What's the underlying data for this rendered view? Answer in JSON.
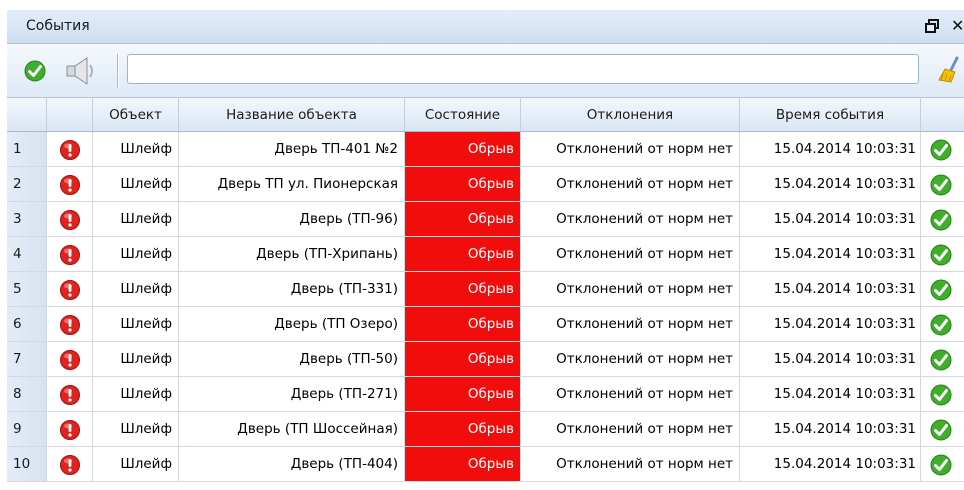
{
  "window": {
    "title": "События"
  },
  "icons": {
    "restore": "restore-window-icon",
    "close": "close-icon",
    "acknowledge": "green-check-icon",
    "sound": "speaker-icon",
    "clear": "broom-icon",
    "event_status": "red-exclamation-icon"
  },
  "colors": {
    "alarm": "#f20d0d",
    "ok_green": "#3fae2a",
    "header_blue": "#dae6f3"
  },
  "toolbar": {
    "search_value": ""
  },
  "table": {
    "columns": [
      "",
      "",
      "Объект",
      "Название объекта",
      "Состояние",
      "Отклонения",
      "Время события",
      ""
    ],
    "rows": [
      {
        "num": "1",
        "object": "Шлейф",
        "name": "Дверь ТП-401 №2",
        "state": "Обрыв",
        "deviations": "Отклонений от норм нет",
        "time": "15.04.2014 10:03:31"
      },
      {
        "num": "2",
        "object": "Шлейф",
        "name": "Дверь ТП ул. Пионерская",
        "state": "Обрыв",
        "deviations": "Отклонений от норм нет",
        "time": "15.04.2014 10:03:31"
      },
      {
        "num": "3",
        "object": "Шлейф",
        "name": "Дверь (ТП-96)",
        "state": "Обрыв",
        "deviations": "Отклонений от норм нет",
        "time": "15.04.2014 10:03:31"
      },
      {
        "num": "4",
        "object": "Шлейф",
        "name": "Дверь (ТП-Хрипань)",
        "state": "Обрыв",
        "deviations": "Отклонений от норм нет",
        "time": "15.04.2014 10:03:31"
      },
      {
        "num": "5",
        "object": "Шлейф",
        "name": "Дверь (ТП-331)",
        "state": "Обрыв",
        "deviations": "Отклонений от норм нет",
        "time": "15.04.2014 10:03:31"
      },
      {
        "num": "6",
        "object": "Шлейф",
        "name": "Дверь (ТП Озеро)",
        "state": "Обрыв",
        "deviations": "Отклонений от норм нет",
        "time": "15.04.2014 10:03:31"
      },
      {
        "num": "7",
        "object": "Шлейф",
        "name": "Дверь (ТП-50)",
        "state": "Обрыв",
        "deviations": "Отклонений от норм нет",
        "time": "15.04.2014 10:03:31"
      },
      {
        "num": "8",
        "object": "Шлейф",
        "name": "Дверь (ТП-271)",
        "state": "Обрыв",
        "deviations": "Отклонений от норм нет",
        "time": "15.04.2014 10:03:31"
      },
      {
        "num": "9",
        "object": "Шлейф",
        "name": "Дверь (ТП Шоссейная)",
        "state": "Обрыв",
        "deviations": "Отклонений от норм нет",
        "time": "15.04.2014 10:03:31"
      },
      {
        "num": "10",
        "object": "Шлейф",
        "name": "Дверь (ТП-404)",
        "state": "Обрыв",
        "deviations": "Отклонений от норм нет",
        "time": "15.04.2014 10:03:31"
      }
    ]
  }
}
